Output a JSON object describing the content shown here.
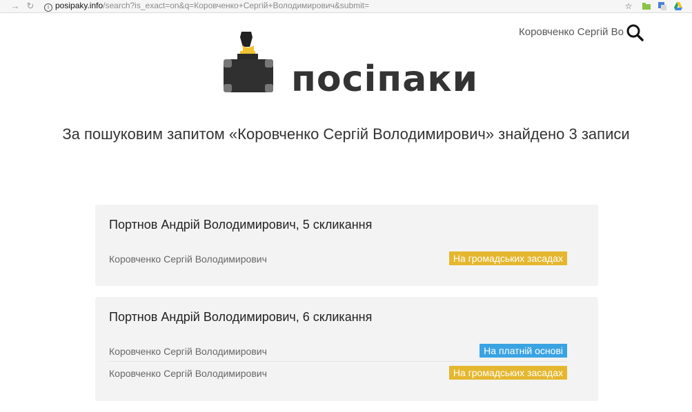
{
  "browser": {
    "url_host": "posipaky.info",
    "url_path": "/search?is_exact=on&q=Коровченко+Сергій+Володимирович&submit="
  },
  "header": {
    "search_value": "Коровченко Сергій Володимирович",
    "logo_text": "посіпаки"
  },
  "main": {
    "headline": "За пошуковим запитом «Коровченко Сергій Володимирович» знайдено 3 записи"
  },
  "cards": [
    {
      "title": "Портнов Андрій Володимирович, 5 скликання",
      "entries": [
        {
          "name": "Коровченко Сергій Володимирович",
          "badge": "На громадських засадах",
          "badge_color": "#e5b72f"
        }
      ]
    },
    {
      "title": "Портнов Андрій Володимирович, 6 скликання",
      "entries": [
        {
          "name": "Коровченко Сергій Володимирович",
          "badge": "На платній основі",
          "badge_color": "#3aa3e2"
        },
        {
          "name": "Коровченко Сергій Володимирович",
          "badge": "На громадських засадах",
          "badge_color": "#e5b72f"
        }
      ]
    }
  ]
}
